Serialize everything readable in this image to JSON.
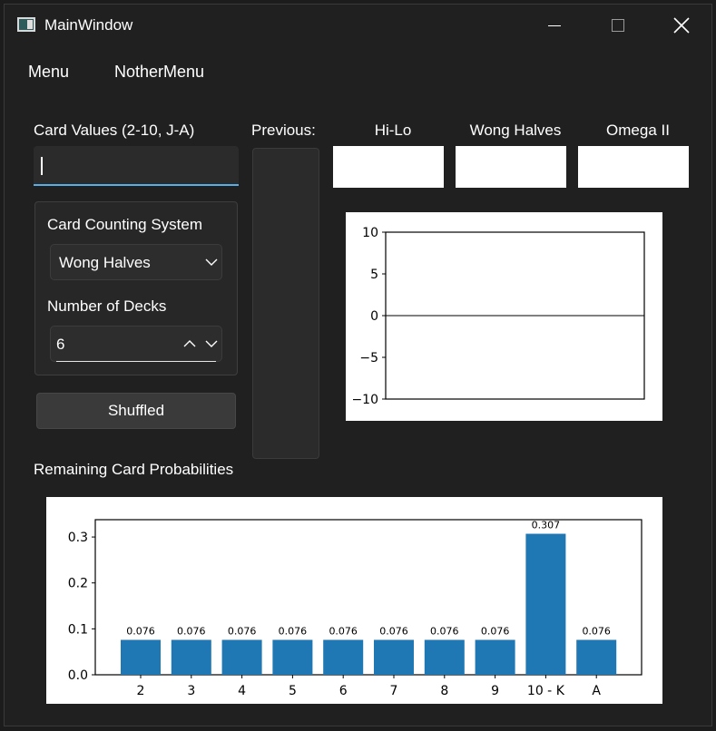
{
  "window": {
    "title": "MainWindow"
  },
  "menubar": {
    "items": [
      "Menu",
      "NotherMenu"
    ]
  },
  "left": {
    "card_values_label": "Card Values (2-10, J-A)",
    "card_values_value": "",
    "system_label": "Card Counting System",
    "system_selected": "Wong Halves",
    "decks_label": "Number of Decks",
    "decks_value": "6",
    "shuffle_button": "Shuffled"
  },
  "previous": {
    "label": "Previous:"
  },
  "counts": {
    "hilo_label": "Hi-Lo",
    "wong_label": "Wong Halves",
    "omega_label": "Omega II",
    "hilo_value": "",
    "wong_value": "",
    "omega_value": ""
  },
  "probabilities": {
    "label": "Remaining Card Probabilities"
  },
  "chart_data": [
    {
      "type": "line",
      "x": [],
      "series": [],
      "ylim": [
        -10,
        10
      ],
      "yticks": [
        "10",
        "5",
        "0",
        "−5",
        "−10"
      ],
      "reference_line_y": 0,
      "title": "",
      "xlabel": "",
      "ylabel": ""
    },
    {
      "type": "bar",
      "categories": [
        "2",
        "3",
        "4",
        "5",
        "6",
        "7",
        "8",
        "9",
        "10 - K",
        "A"
      ],
      "values": [
        0.076,
        0.076,
        0.076,
        0.076,
        0.076,
        0.076,
        0.076,
        0.076,
        0.307,
        0.076
      ],
      "data_labels": [
        "0.076",
        "0.076",
        "0.076",
        "0.076",
        "0.076",
        "0.076",
        "0.076",
        "0.076",
        "0.307",
        "0.076"
      ],
      "yticks": [
        "0.0",
        "0.1",
        "0.2",
        "0.3"
      ],
      "ytick_values": [
        0.0,
        0.1,
        0.2,
        0.3
      ],
      "ylim": [
        0,
        0.3377
      ],
      "bar_color": "#1f77b4",
      "title": "",
      "xlabel": "",
      "ylabel": ""
    }
  ]
}
